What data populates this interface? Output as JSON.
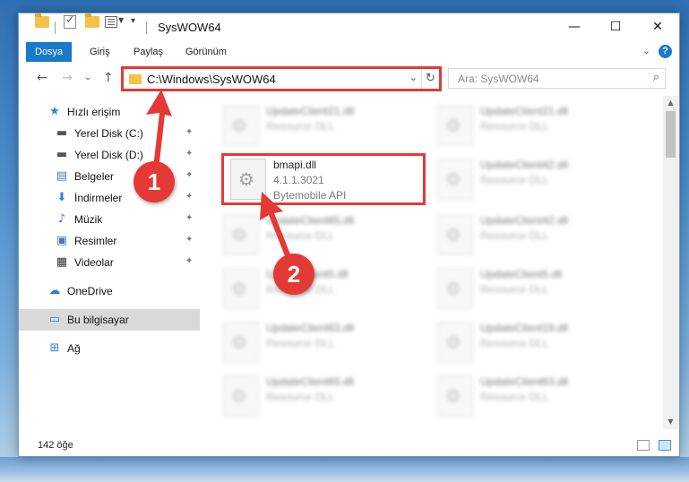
{
  "window": {
    "title": "SysWOW64",
    "minimize_glyph": "—",
    "maximize_glyph": "☐",
    "close_glyph": "✕"
  },
  "ribbon": {
    "tabs": [
      {
        "label": "Dosya",
        "active": true
      },
      {
        "label": "Giriş",
        "active": false
      },
      {
        "label": "Paylaş",
        "active": false
      },
      {
        "label": "Görünüm",
        "active": false
      }
    ],
    "collapse_glyph": "⌄",
    "help_glyph": "?"
  },
  "nav": {
    "back_glyph": "←",
    "forward_glyph": "→",
    "recent_glyph": "⌄",
    "up_glyph": "↑"
  },
  "address": {
    "path": "C:\\Windows\\SysWOW64",
    "dropdown_glyph": "⌄",
    "refresh_glyph": "↻"
  },
  "search": {
    "placeholder": "Ara: SysWOW64",
    "icon_glyph": "⌕"
  },
  "sidebar": {
    "items": [
      {
        "label": "Hızlı erişim",
        "icon": "star-icon",
        "glyph": "★",
        "color": "#2f7fd6"
      },
      {
        "label": "Yerel Disk (C:)",
        "icon": "drive-icon",
        "glyph": "▬",
        "color": "#555555",
        "pinned": true
      },
      {
        "label": "Yerel Disk (D:)",
        "icon": "drive-icon",
        "glyph": "▬",
        "color": "#555555",
        "pinned": true
      },
      {
        "label": "Belgeler",
        "icon": "documents-icon",
        "glyph": "▤",
        "color": "#4a78b0",
        "pinned": true
      },
      {
        "label": "İndirmeler",
        "icon": "download-icon",
        "glyph": "⬇",
        "color": "#2f7fd6",
        "pinned": true
      },
      {
        "label": "Müzik",
        "icon": "music-icon",
        "glyph": "♪",
        "color": "#2f7fd6",
        "pinned": true
      },
      {
        "label": "Resimler",
        "icon": "pictures-icon",
        "glyph": "▣",
        "color": "#4a78b0",
        "pinned": true
      },
      {
        "label": "Videolar",
        "icon": "video-icon",
        "glyph": "▦",
        "color": "#333333",
        "pinned": true
      },
      {
        "label": "OneDrive",
        "icon": "cloud-icon",
        "glyph": "☁",
        "color": "#2f7fd6"
      },
      {
        "label": "Bu bilgisayar",
        "icon": "computer-icon",
        "glyph": "▭",
        "color": "#2f7fd6",
        "selected": true
      },
      {
        "label": "Ağ",
        "icon": "network-icon",
        "glyph": "⊞",
        "color": "#2f7fd6"
      }
    ],
    "pin_glyph": "📌"
  },
  "files": {
    "highlighted": {
      "name": "bmapi.dll",
      "version": "4.1.1.3021",
      "description": "Bytemobile API"
    },
    "left_column": [
      {
        "name": "UpdateClient21.dll",
        "description": "Resource DLL"
      },
      {
        "name": "UpdateClient65.dll",
        "description": "Resource DLL"
      },
      {
        "name": "UpdateClient5.dll",
        "description": "Resource DLL"
      },
      {
        "name": "UpdateClient63.dll",
        "description": "Resource DLL"
      },
      {
        "name": "UpdateClient65.dll",
        "description": "Resource DLL"
      }
    ],
    "right_column": [
      {
        "name": "UpdateClient21.dll",
        "description": "Resource DLL"
      },
      {
        "name": "UpdateClient42.dll",
        "description": "Resource DLL"
      },
      {
        "name": "UpdateClient42.dll",
        "description": "Resource DLL"
      },
      {
        "name": "UpdateClient5.dll",
        "description": "Resource DLL"
      },
      {
        "name": "UpdateClient19.dll",
        "description": "Resource DLL"
      },
      {
        "name": "UpdateClient63.dll",
        "description": "Resource DLL"
      }
    ]
  },
  "status": {
    "item_count": "142 öğe"
  },
  "annotations": {
    "step1": "1",
    "step2": "2",
    "color": "#e53935"
  },
  "scrollbar": {
    "up_glyph": "▲",
    "down_glyph": "▼"
  }
}
